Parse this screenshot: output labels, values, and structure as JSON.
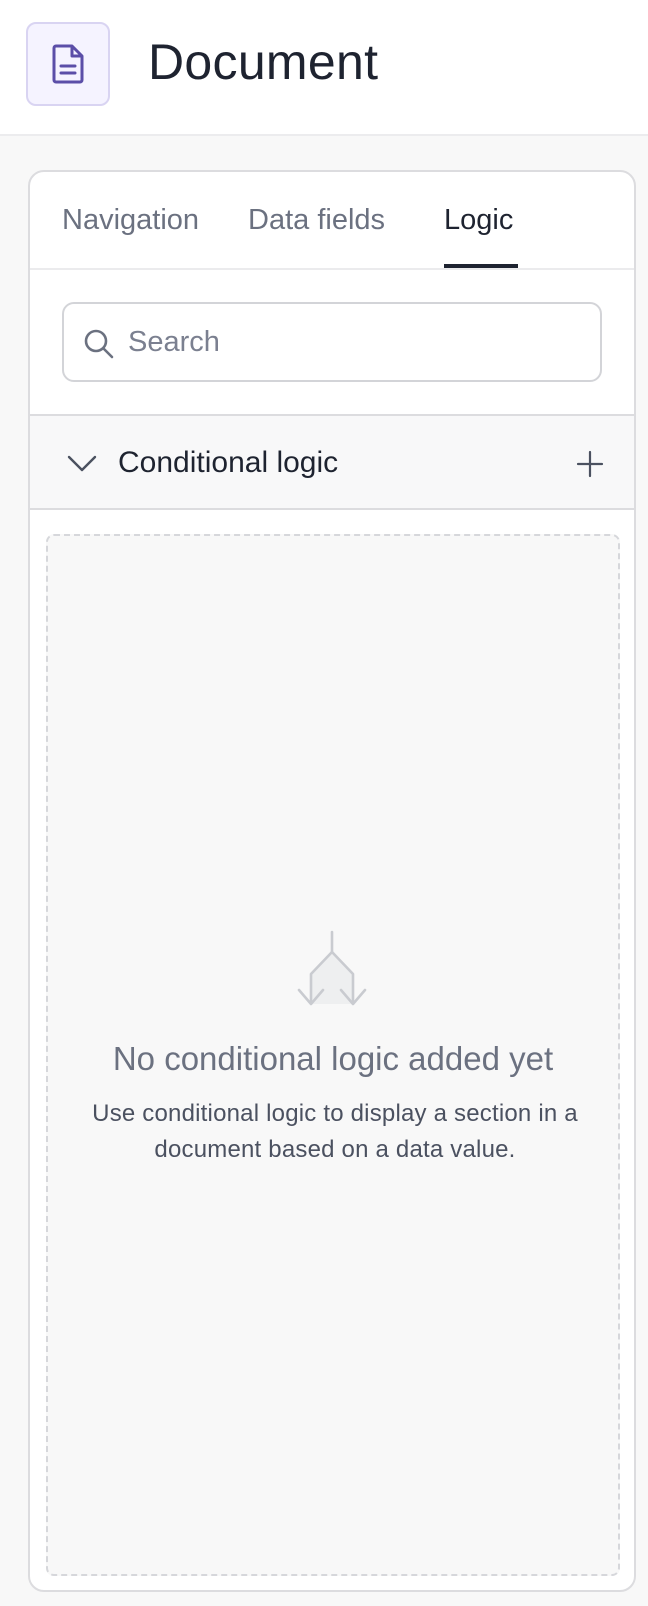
{
  "header": {
    "title": "Document",
    "icon": "document-icon",
    "accent_color": "#5b4ea8"
  },
  "tabs": [
    {
      "label": "Navigation",
      "active": false
    },
    {
      "label": "Data fields",
      "active": false
    },
    {
      "label": "Logic",
      "active": true
    }
  ],
  "search": {
    "placeholder": "Search",
    "value": ""
  },
  "section": {
    "title": "Conditional logic",
    "expanded": true,
    "collapse_icon": "chevron-down-icon",
    "add_icon": "plus-icon"
  },
  "empty_state": {
    "icon": "branch-icon",
    "title": "No conditional logic added yet",
    "description": "Use conditional logic to display a section in a document based on a data value."
  }
}
